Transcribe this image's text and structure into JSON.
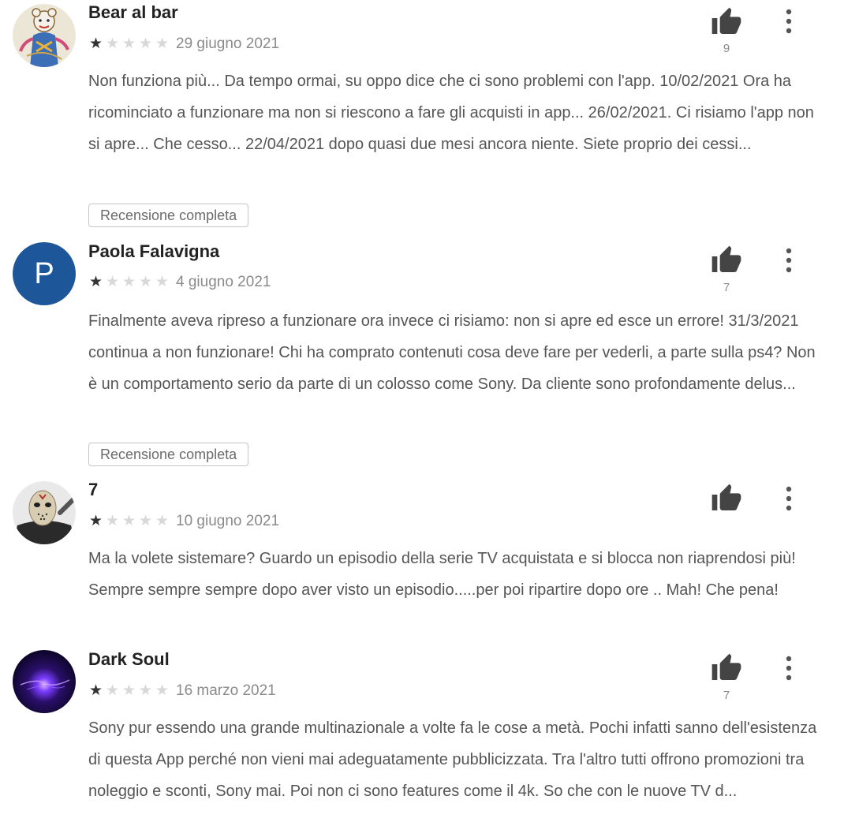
{
  "reviews": [
    {
      "author": "Bear al bar",
      "rating": 1,
      "max_rating": 5,
      "date": "29 giugno 2021",
      "text": "Non funziona più... Da tempo ormai, su oppo dice che ci sono problemi con l'app. 10/02/2021 Ora ha ricominciato a funzionare ma non si riescono a fare gli acquisti in app... 26/02/2021. Ci risiamo l'app non si apre... Che cesso... 22/04/2021 dopo quasi due mesi ancora niente. Siete proprio dei cessi...",
      "full_review_label": "Recensione completa",
      "helpful_count": "9",
      "avatar_icon": "cartoon-bear-avatar"
    },
    {
      "author": "Paola Falavigna",
      "rating": 1,
      "max_rating": 5,
      "date": "4 giugno 2021",
      "text": "Finalmente aveva ripreso a funzionare ora invece ci risiamo: non si apre ed esce un errore! 31/3/2021 continua a non funzionare! Chi ha comprato contenuti cosa deve fare per vederli, a parte sulla ps4? Non è un comportamento serio da parte di un colosso come Sony. Da cliente sono profondamente delus...",
      "full_review_label": "Recensione completa",
      "helpful_count": "7",
      "avatar_letter": "P",
      "avatar_color": "#1e5799"
    },
    {
      "author": "7",
      "rating": 1,
      "max_rating": 5,
      "date": "10 giugno 2021",
      "text": "Ma la volete sistemare? Guardo un episodio della serie TV acquistata e si blocca non riaprendosi più! Sempre sempre sempre dopo aver visto un episodio.....per poi ripartire dopo ore .. Mah! Che pena!",
      "helpful_count": "",
      "avatar_icon": "hockey-mask-avatar"
    },
    {
      "author": "Dark Soul",
      "rating": 1,
      "max_rating": 5,
      "date": "16 marzo 2021",
      "text": "Sony pur essendo una grande multinazionale a volte fa le cose a metà. Pochi infatti sanno dell'esistenza di questa App perché non vieni mai adeguatamente pubblicizzata. Tra l'altro tutti offrono promozioni tra noleggio e sconti, Sony mai. Poi non ci sono features come il 4k. So che con le nuove TV d...",
      "helpful_count": "7",
      "avatar_icon": "purple-nebula-avatar"
    }
  ],
  "icons": {
    "helpful": "thumbs-up-icon",
    "more": "more-vert-icon",
    "star_on_color": "#333333",
    "star_off_color": "#d8d8d8"
  }
}
